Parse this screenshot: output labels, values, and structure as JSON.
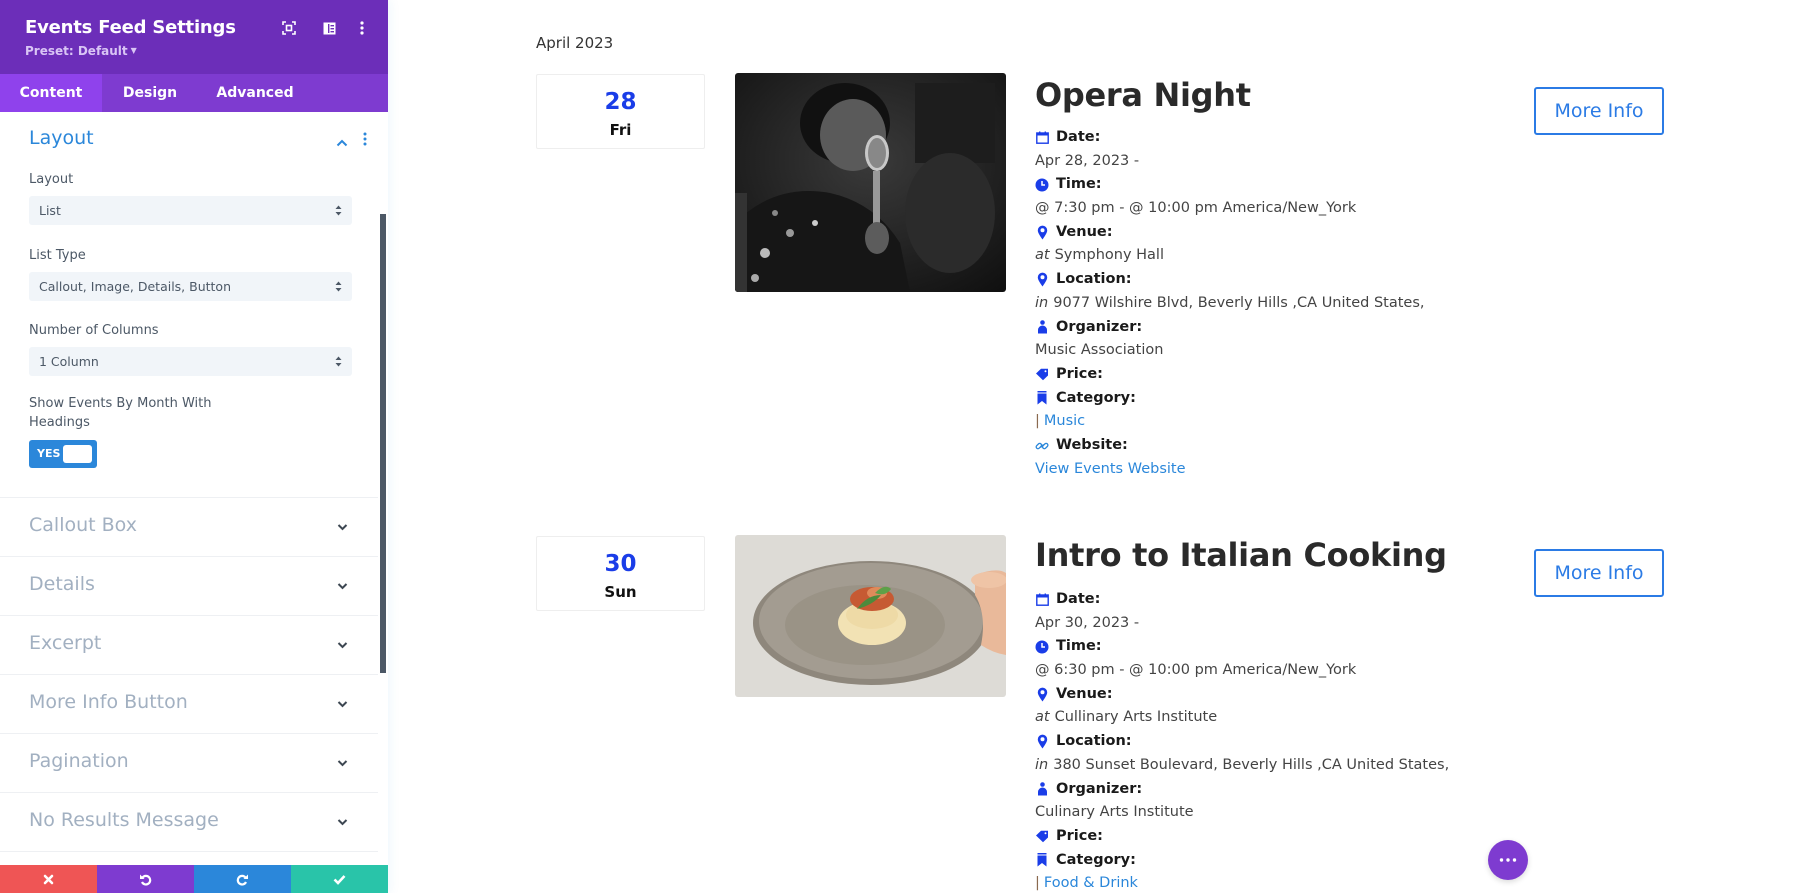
{
  "sidebar": {
    "title": "Events Feed Settings",
    "preset": "Preset: Default",
    "header_icons": [
      "focus-mode-icon",
      "split-view-icon",
      "more-options-icon"
    ],
    "tabs": [
      {
        "label": "Content",
        "active": true
      },
      {
        "label": "Design",
        "active": false
      },
      {
        "label": "Advanced",
        "active": false
      }
    ],
    "open_section": {
      "title": "Layout",
      "fields": [
        {
          "label": "Layout",
          "value": "List"
        },
        {
          "label": "List Type",
          "value": "Callout, Image, Details, Button"
        },
        {
          "label": "Number of Columns",
          "value": "1 Column"
        }
      ],
      "toggle": {
        "label_line1": "Show Events By Month With",
        "label_line2": "Headings",
        "value": "YES"
      }
    },
    "sections": [
      {
        "label": "Callout Box"
      },
      {
        "label": "Details"
      },
      {
        "label": "Excerpt"
      },
      {
        "label": "More Info Button"
      },
      {
        "label": "Pagination"
      },
      {
        "label": "No Results Message"
      }
    ],
    "footer": [
      "discard",
      "undo",
      "redo",
      "save"
    ]
  },
  "colors": {
    "header_purple": "#6c2eb9",
    "tab_purple": "#7e3bd0",
    "accent_blue": "#2b87da",
    "date_blue": "#1a3de8",
    "discard_red": "#ef5555",
    "save_green": "#29c4a9"
  },
  "feed": {
    "month_heading": "April 2023",
    "events": [
      {
        "day": "28",
        "weekday": "Fri",
        "title": "Opera Night",
        "image": "black-and-white photo of singer at microphone",
        "date_label": "Date:",
        "date_value": "Apr 28, 2023 -",
        "time_label": "Time:",
        "time_value": "@ 7:30 pm - @ 10:00 pm America/New_York",
        "venue_label": "Venue:",
        "venue_prefix": "at",
        "venue_value": "Symphony Hall",
        "location_label": "Location:",
        "location_prefix": "in",
        "location_value": "9077 Wilshire Blvd, Beverly Hills ,CA United States,",
        "organizer_label": "Organizer:",
        "organizer_value": "Music Association",
        "price_label": "Price:",
        "category_label": "Category:",
        "category_pipe": "|",
        "category_value": "Music",
        "website_label": "Website:",
        "website_value": "View Events Website",
        "button": "More Info"
      },
      {
        "day": "30",
        "weekday": "Sun",
        "title": "Intro to Italian Cooking",
        "image": "plate of spaghetti with tomato sauce and basil",
        "date_label": "Date:",
        "date_value": "Apr 30, 2023 -",
        "time_label": "Time:",
        "time_value": "@ 6:30 pm - @ 10:00 pm America/New_York",
        "venue_label": "Venue:",
        "venue_prefix": "at",
        "venue_value": "Cullinary Arts Institute",
        "location_label": "Location:",
        "location_prefix": "in",
        "location_value": "380 Sunset Boulevard, Beverly Hills ,CA United States,",
        "organizer_label": "Organizer:",
        "organizer_value": "Culinary Arts Institute",
        "price_label": "Price:",
        "category_label": "Category:",
        "category_pipe": "|",
        "category_value": "Food & Drink",
        "button": "More Info"
      }
    ]
  },
  "floating_button": "more-actions"
}
